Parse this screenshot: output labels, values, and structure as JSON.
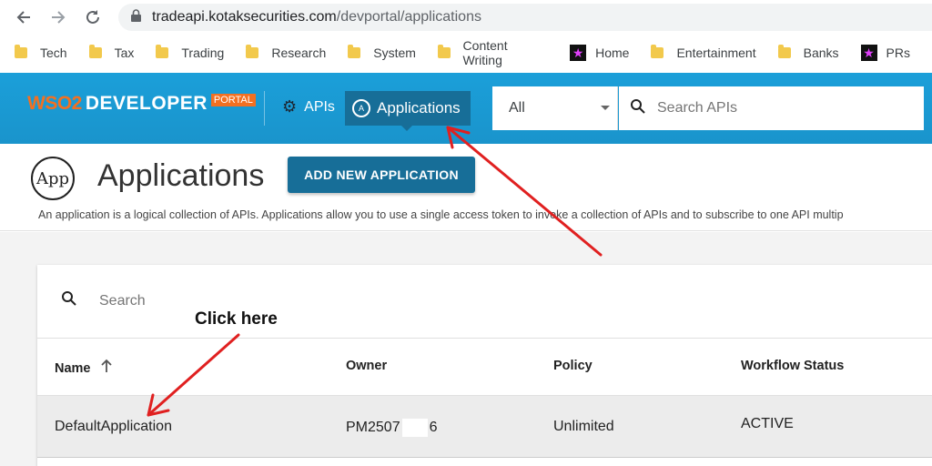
{
  "browser": {
    "url_host": "tradeapi.kotaksecurities.com",
    "url_path": "/devportal/applications"
  },
  "bookmarks": [
    {
      "label": "Tech",
      "icon": "folder-icon"
    },
    {
      "label": "Tax",
      "icon": "folder-icon"
    },
    {
      "label": "Trading",
      "icon": "folder-icon"
    },
    {
      "label": "Research",
      "icon": "folder-icon"
    },
    {
      "label": "System",
      "icon": "folder-icon"
    },
    {
      "label": "Content Writing",
      "icon": "folder-icon"
    },
    {
      "label": "Home",
      "icon": "star-icon"
    },
    {
      "label": "Entertainment",
      "icon": "folder-icon"
    },
    {
      "label": "Banks",
      "icon": "folder-icon"
    },
    {
      "label": "PRs",
      "icon": "star-icon"
    }
  ],
  "header": {
    "logo_wso2": "WSO2",
    "logo_developer": "DEVELOPER",
    "logo_portal": "PORTAL",
    "nav_apis": "APIs",
    "nav_applications": "Applications",
    "scope_value": "All",
    "search_placeholder": "Search APIs"
  },
  "page": {
    "title": "Applications",
    "app_logo_text": "App",
    "add_button": "ADD NEW APPLICATION",
    "description": "An application is a logical collection of APIs. Applications allow you to use a single access token to invoke a collection of APIs and to subscribe to one API multip"
  },
  "table": {
    "search_placeholder": "Search",
    "columns": [
      "Name",
      "Owner",
      "Policy",
      "Workflow Status"
    ],
    "rows": [
      {
        "name": "DefaultApplication",
        "owner_prefix": "PM2507",
        "owner_suffix": "6",
        "policy": "Unlimited",
        "status": "ACTIVE"
      }
    ]
  },
  "annotation": {
    "label": "Click here",
    "color": "#e02020"
  },
  "colors": {
    "header_blue": "#1b9fd9",
    "nav_active": "#176e98",
    "wso2_orange": "#f37021"
  }
}
